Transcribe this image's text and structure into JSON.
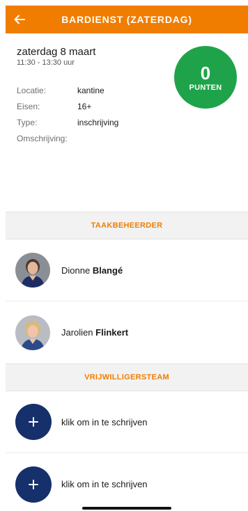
{
  "header": {
    "title": "BARDIENST (ZATERDAG)",
    "back_icon": "arrow-left-icon",
    "color": "#f07d00"
  },
  "event": {
    "date": "zaterdag 8 maart",
    "time": "11:30 - 13:30 uur",
    "fields": [
      {
        "label": "Locatie:",
        "value": "kantine"
      },
      {
        "label": "Eisen:",
        "value": "16+"
      },
      {
        "label": "Type:",
        "value": "inschrijving"
      },
      {
        "label": "Omschrijving:",
        "value": ""
      }
    ]
  },
  "points": {
    "value": "0",
    "label": "PUNTEN",
    "color": "#1fa34a"
  },
  "task_managers": {
    "title": "TAAKBEHEERDER",
    "people": [
      {
        "first_name": "Dionne",
        "last_name": "Blangé",
        "avatar": "avatar-photo-icon"
      },
      {
        "first_name": "Jarolien",
        "last_name": "Flinkert",
        "avatar": "avatar-photo-icon"
      }
    ]
  },
  "volunteers": {
    "title": "VRIJWILLIGERSTEAM",
    "slots": [
      {
        "label": "klik om in te schrijven",
        "icon": "plus-icon"
      },
      {
        "label": "klik om in te schrijven",
        "icon": "plus-icon"
      }
    ],
    "button_color": "#16306b"
  }
}
